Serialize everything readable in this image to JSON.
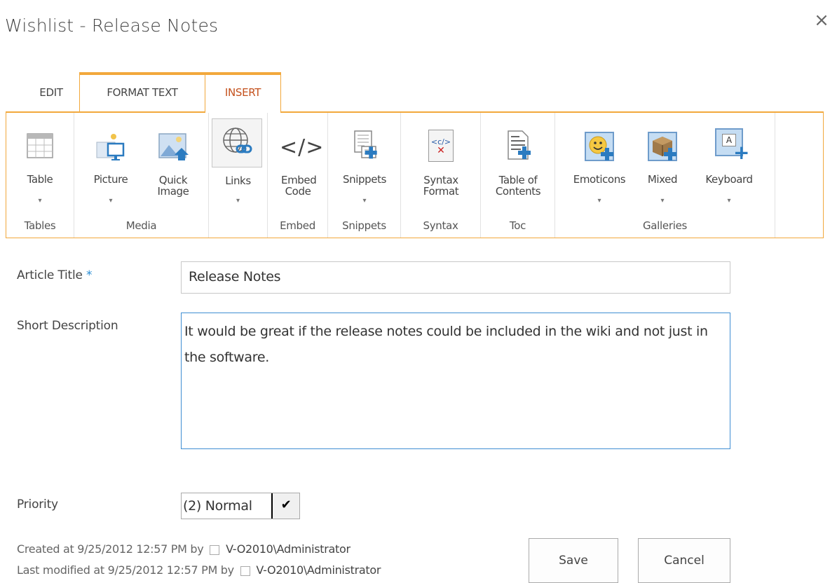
{
  "dialog": {
    "title": "Wishlist - Release Notes",
    "close_glyph": "×"
  },
  "tabs": [
    {
      "label": "EDIT"
    },
    {
      "label": "FORMAT TEXT"
    },
    {
      "label": "INSERT",
      "active": true
    }
  ],
  "ribbon": {
    "groups": [
      {
        "label": "Tables",
        "buttons": [
          {
            "label": "Table",
            "icon": "table-icon",
            "dropdown": true
          }
        ]
      },
      {
        "label": "Media",
        "buttons": [
          {
            "label": "Picture",
            "icon": "picture-icon",
            "dropdown": true
          },
          {
            "label": "Quick Image",
            "icon": "quick-image-icon",
            "dropdown": false
          }
        ]
      },
      {
        "label": "",
        "buttons": [
          {
            "label": "Links",
            "icon": "links-icon",
            "dropdown": true
          }
        ]
      },
      {
        "label": "Embed",
        "buttons": [
          {
            "label": "Embed Code",
            "icon": "embed-code-icon",
            "glyph": "</>",
            "dropdown": false
          }
        ]
      },
      {
        "label": "Snippets",
        "buttons": [
          {
            "label": "Snippets",
            "icon": "snippets-icon",
            "dropdown": true
          }
        ]
      },
      {
        "label": "Syntax",
        "buttons": [
          {
            "label": "Syntax Format",
            "icon": "syntax-format-icon",
            "glyph": "<c/>",
            "dropdown": true
          }
        ]
      },
      {
        "label": "Toc",
        "buttons": [
          {
            "label": "Table of Contents",
            "icon": "table-of-contents-icon",
            "dropdown": false
          }
        ]
      },
      {
        "label": "Galleries",
        "buttons": [
          {
            "label": "Emoticons",
            "icon": "emoticons-icon",
            "dropdown": true
          },
          {
            "label": "Mixed",
            "icon": "mixed-icon",
            "dropdown": true
          },
          {
            "label": "Keyboard",
            "icon": "keyboard-icon",
            "glyph": "A",
            "dropdown": true
          }
        ]
      }
    ],
    "dropdown_glyph": "▾"
  },
  "form": {
    "article_title_label": "Article Title",
    "required_marker": "*",
    "article_title_value": "Release Notes",
    "short_description_label": "Short Description",
    "short_description_value": "It would be great if the release notes could be included in the wiki and not just in the software.",
    "priority_label": "Priority",
    "priority_value": "(2) Normal",
    "select_arrow_glyph": "✔"
  },
  "meta": {
    "created_prefix": "Created at 9/25/2012 12:57 PM  by",
    "created_user": "V-O2010\\Administrator",
    "modified_prefix": "Last modified at 9/25/2012 12:57 PM  by",
    "modified_user": "V-O2010\\Administrator"
  },
  "buttons": {
    "save": "Save",
    "cancel": "Cancel"
  },
  "colors": {
    "accent_orange": "#f2a83c",
    "active_tab_text": "#c4511d",
    "focus_blue": "#3f8ed3",
    "required_blue": "#2a8dd4"
  }
}
